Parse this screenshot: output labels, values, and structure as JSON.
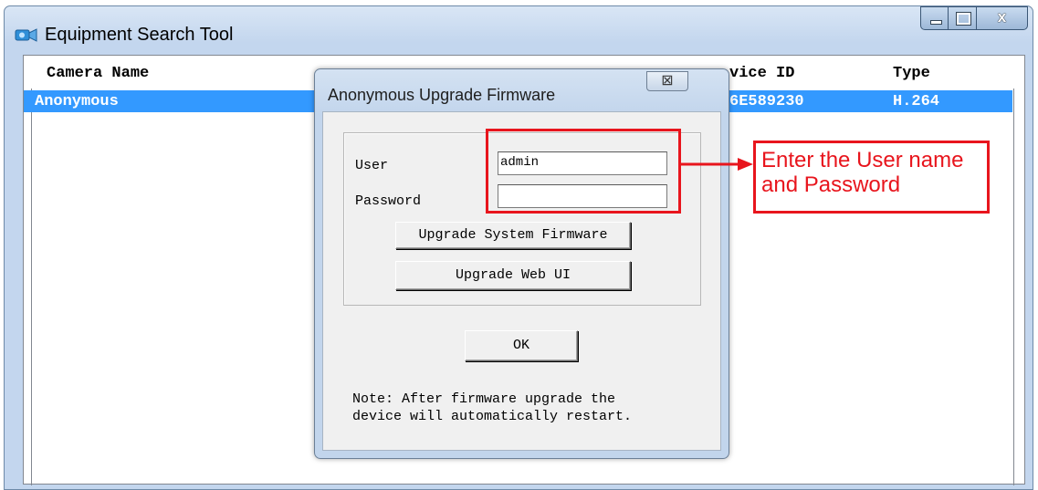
{
  "window": {
    "title": "Equipment Search Tool",
    "close_glyph": "x"
  },
  "list": {
    "columns": {
      "camera_name": "Camera Name",
      "device_id": "vice ID",
      "type": "Type"
    },
    "rows": [
      {
        "camera_name": "Anonymous",
        "device_id": "6E589230",
        "type": "H.264"
      }
    ],
    "selected_bg": "#3399ff"
  },
  "dialog": {
    "title": "Anonymous Upgrade Firmware",
    "close_glyph": "⊠",
    "user_label": "User",
    "user_value": "admin",
    "password_label": "Password",
    "password_value": "",
    "upgrade_system_label": "Upgrade System Firmware",
    "upgrade_web_label": "Upgrade Web UI",
    "ok_label": "OK",
    "note": "Note: After firmware upgrade the\ndevice will automatically restart."
  },
  "annotation": {
    "text_line1": "Enter the User name",
    "text_line2": "and Password",
    "color": "#e8151d"
  }
}
